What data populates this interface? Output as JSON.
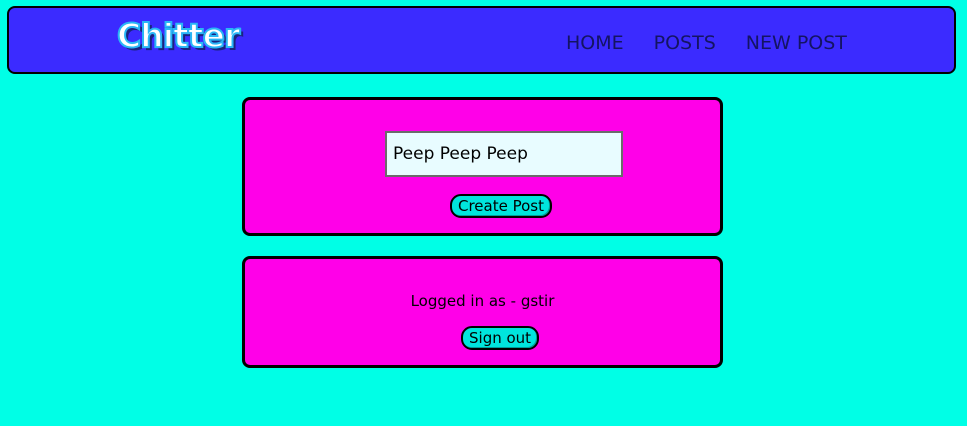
{
  "nav": {
    "logo": "Chitter",
    "links": [
      "HOME",
      "POSTS",
      "NEW POST"
    ]
  },
  "post_form": {
    "input_value": "Peep Peep Peep",
    "submit_label": "Create Post"
  },
  "session": {
    "status_text": "Logged in as - gstir",
    "signout_label": "Sign out"
  },
  "colors": {
    "page_background": "#00ffe6",
    "navbar_background": "#3b2bff",
    "card_background": "#ff00e8",
    "button_background": "#00e5dd",
    "input_background": "#e8fcff",
    "nav_text": "#141463"
  }
}
